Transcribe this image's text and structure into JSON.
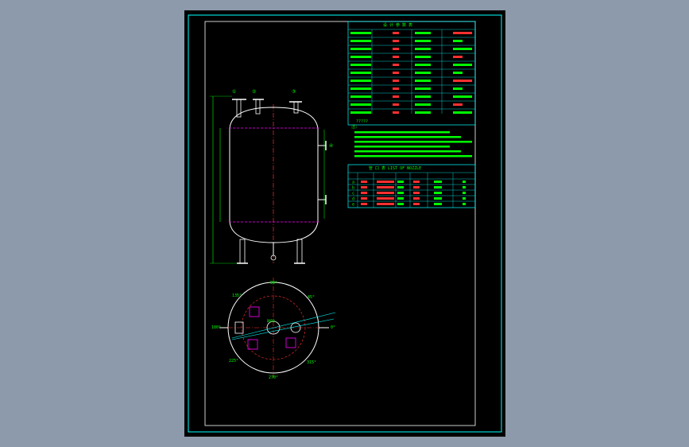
{
  "colors": {
    "background": "#8d9aab",
    "sheet": "#000000",
    "frame": "#00ffff",
    "outline": "#ffffff",
    "centerline": "#ff3030",
    "dimension": "#00ff00",
    "flange": "#ff00ff",
    "table_text": "#00ff00",
    "table_red": "#ff3030"
  },
  "tech_table": {
    "title": "设 计 参 数 表",
    "notes_heading": "?????",
    "notes_prefix": "注:"
  },
  "nozzle_table": {
    "title": "管 口 表  LIST OF NOZZLE",
    "rows": [
      "a",
      "b",
      "c",
      "d",
      "e"
    ]
  },
  "plan_view": {
    "angle_top": "90°",
    "angle_left": "180°",
    "angle_right": "0°",
    "angle_bottom": "270°",
    "angle_45": "45°",
    "angle_135": "135°",
    "angle_225": "225°",
    "angle_315": "315°",
    "center_label": "DN50"
  },
  "callouts": {
    "c1": "①",
    "c2": "②",
    "c3": "③",
    "c4": "④"
  }
}
